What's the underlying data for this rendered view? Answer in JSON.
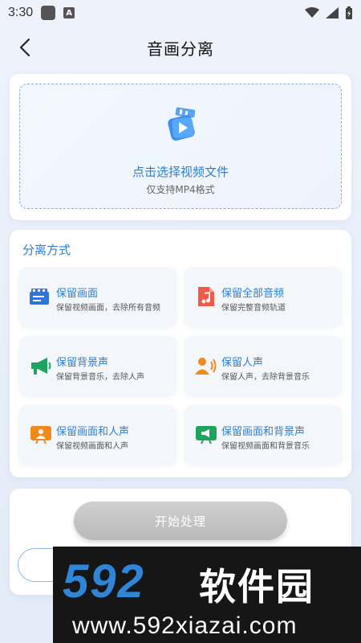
{
  "status_bar": {
    "time": "3:30",
    "a_badge": "A"
  },
  "header": {
    "title": "音画分离"
  },
  "upload": {
    "title": "点击选择视频文件",
    "subtitle": "仅支持MP4格式"
  },
  "modes": {
    "section_title": "分离方式",
    "options": [
      {
        "title": "保留画面",
        "desc": "保留视频画面，去除所有音频",
        "icon": "video-icon",
        "color": "#2f74d6"
      },
      {
        "title": "保留全部音频",
        "desc": "保留完整音频轨道",
        "icon": "audio-file-icon",
        "color": "#ef5a4a"
      },
      {
        "title": "保留背景声",
        "desc": "保留背景音乐，去除人声",
        "icon": "megaphone-icon",
        "color": "#1ea45f"
      },
      {
        "title": "保留人声",
        "desc": "保留人声，去除背景音乐",
        "icon": "speaker-person-icon",
        "color": "#f08a1c"
      },
      {
        "title": "保留画面和人声",
        "desc": "保留视频画面和人声",
        "icon": "presenter-icon",
        "color": "#f08a1c"
      },
      {
        "title": "保留画面和背景声",
        "desc": "保留视频画面和背景音乐",
        "icon": "screen-megaphone-icon",
        "color": "#1ea45f"
      }
    ]
  },
  "actions": {
    "start_label": "开始处理"
  },
  "watermark": {
    "brand_number": "592",
    "brand_cn": "软件园",
    "url": "www.592xiazai.com"
  },
  "colors": {
    "accent": "#2b7fd6",
    "disabled_button": "#bdbdbd"
  }
}
